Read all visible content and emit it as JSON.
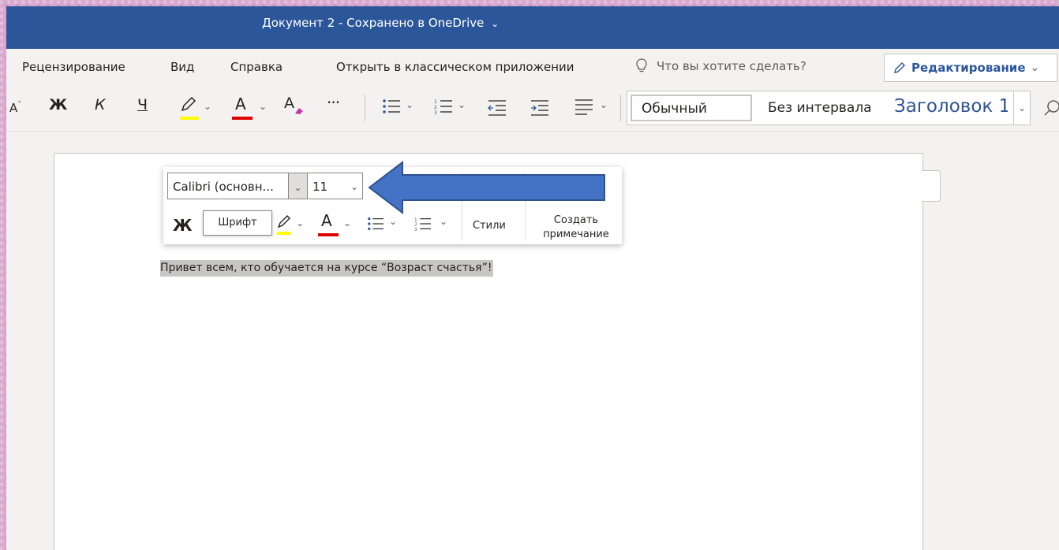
{
  "titlebar": {
    "document_title": "Документ 2  -  Сохранено в OneDrive",
    "chevron_icon": "chevron-down-icon"
  },
  "menubar": {
    "items": [
      "Рецензирование",
      "Вид",
      "Справка",
      "Открыть в классическом приложении"
    ],
    "tell_me_placeholder": "Что вы хотите сделать?",
    "tell_me_icon": "lightbulb-icon",
    "mode_label": "Редактирование",
    "mode_icon": "pencil-icon"
  },
  "ribbon": {
    "bold_glyph": "Ж",
    "italic_glyph": "К",
    "underline_glyph": "Ч",
    "font_color_glyph": "A",
    "clear_format_glyph": "A",
    "more_glyph": "···",
    "highlight_color": "#ffff00",
    "font_color": "#e00000",
    "styles": {
      "normal": "Обычный",
      "no_spacing": "Без интервала",
      "heading1": "Заголовок 1"
    }
  },
  "mini_toolbar": {
    "font_name": "Calibri (основн...",
    "font_size": "11",
    "bold_glyph": "Ж",
    "font_color_glyph": "A",
    "styles_label": "Стили",
    "comment_label_line1": "Создать",
    "comment_label_line2": "примечание",
    "tooltip": "Шрифт"
  },
  "document": {
    "selected_text": "Привет всем, кто обучается на курсе “Возраст счастья”!"
  },
  "colors": {
    "title_bar": "#2b579a",
    "arrow": "#4472c4",
    "selection": "#c8c6c4"
  }
}
